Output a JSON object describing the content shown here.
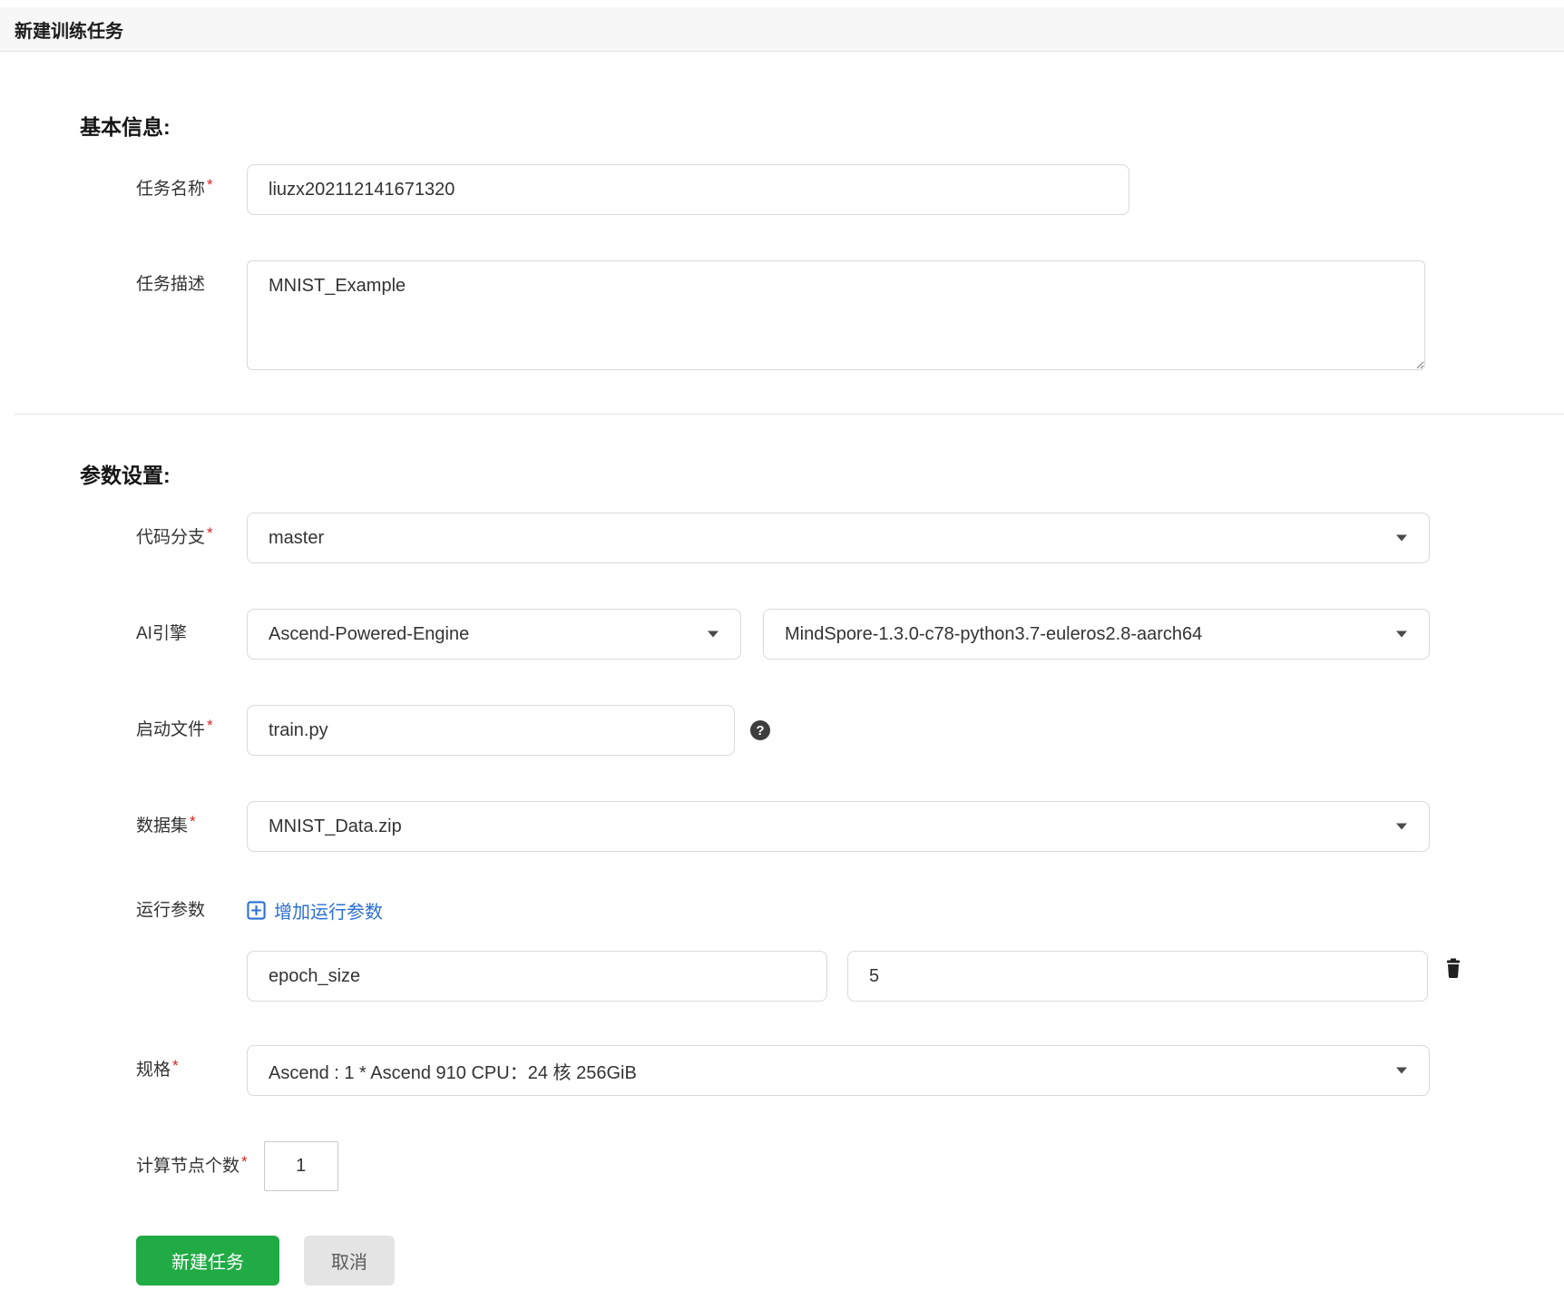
{
  "page": {
    "title": "新建训练任务"
  },
  "ui": {
    "required_marker": "*"
  },
  "icons": {
    "help_glyph": "?",
    "plus_square": "plus-square-outline",
    "trash": "trash-filled",
    "caret": "chevron-down"
  },
  "colors": {
    "accent_green": "#21ab45",
    "link_blue": "#2b6fd4",
    "required_red": "#e02020",
    "header_bg": "#f7f7f7",
    "input_border": "#d9d9d9"
  },
  "sections": {
    "basic": {
      "title": "基本信息:"
    },
    "params": {
      "title": "参数设置:"
    }
  },
  "fields": {
    "task_name": {
      "label": "任务名称",
      "value": "liuzx202112141671320"
    },
    "task_desc": {
      "label": "任务描述",
      "value": "MNIST_Example"
    },
    "code_branch": {
      "label": "代码分支",
      "value": "master"
    },
    "ai_engine": {
      "label": "AI引擎",
      "engine": "Ascend-Powered-Engine",
      "version": "MindSpore-1.3.0-c78-python3.7-euleros2.8-aarch64"
    },
    "boot_file": {
      "label": "启动文件",
      "value": "train.py"
    },
    "dataset": {
      "label": "数据集",
      "value": "MNIST_Data.zip"
    },
    "run_args": {
      "label": "运行参数",
      "add_link_label": "增加运行参数",
      "rows": [
        {
          "key": "epoch_size",
          "value": "5"
        }
      ]
    },
    "spec": {
      "label": "规格",
      "value": "Ascend : 1 * Ascend 910 CPU：24 核 256GiB"
    },
    "node_count": {
      "label": "计算节点个数",
      "value": "1"
    }
  },
  "buttons": {
    "create": "新建任务",
    "cancel": "取消"
  }
}
